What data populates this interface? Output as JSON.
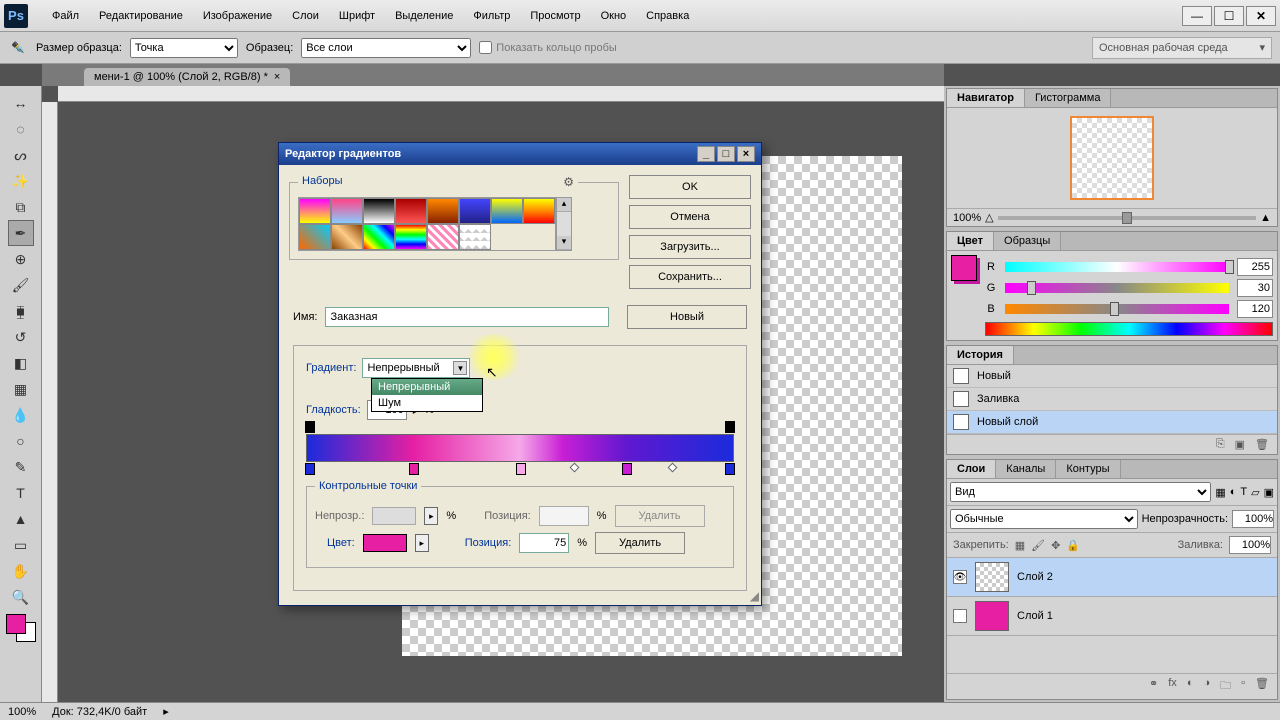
{
  "app": {
    "logo": "Ps"
  },
  "menu": [
    "Файл",
    "Редактирование",
    "Изображение",
    "Слои",
    "Шрифт",
    "Выделение",
    "Фильтр",
    "Просмотр",
    "Окно",
    "Справка"
  ],
  "optbar": {
    "sample_label": "Размер образца:",
    "sample_value": "Точка",
    "src_label": "Образец:",
    "src_value": "Все слои",
    "ring_label": "Показать кольцо пробы",
    "workspace": "Основная рабочая среда"
  },
  "doctab": {
    "title": "мени-1 @ 100% (Слой 2, RGB/8) *"
  },
  "panels": {
    "navigator": {
      "tab1": "Навигатор",
      "tab2": "Гистограмма",
      "zoom": "100%"
    },
    "color": {
      "tab1": "Цвет",
      "tab2": "Образцы",
      "r": "255",
      "g": "30",
      "b": "120"
    },
    "history": {
      "tab": "История",
      "items": [
        "Новый",
        "Заливка",
        "Новый слой"
      ]
    },
    "layers": {
      "tab1": "Слои",
      "tab2": "Каналы",
      "tab3": "Контуры",
      "filter": "Вид",
      "blend": "Обычные",
      "opacity_lbl": "Непрозрачность:",
      "opacity": "100%",
      "lock_lbl": "Закрепить:",
      "fill_lbl": "Заливка:",
      "fill": "100%",
      "items": [
        "Слой 2",
        "Слой 1"
      ]
    }
  },
  "dialog": {
    "title": "Редактор градиентов",
    "presets_lbl": "Наборы",
    "ok": "OK",
    "cancel": "Отмена",
    "load": "Загрузить...",
    "save": "Сохранить...",
    "name_lbl": "Имя:",
    "name_value": "Заказная",
    "new_btn": "Новый",
    "type_lbl": "Градиент:",
    "type_value": "Непрерывный",
    "dd_opt1": "Непрерывный",
    "dd_opt2": "Шум",
    "smooth_lbl": "Гладкость:",
    "smooth_value": "100",
    "cp_lbl": "Контрольные точки",
    "opacity_lbl": "Непрозр.:",
    "pos_lbl": "Позиция:",
    "pos_value": "75",
    "color_lbl": "Цвет:",
    "delete": "Удалить",
    "pct": "%"
  },
  "status": {
    "zoom": "100%",
    "doc": "Док: 732,4K/0 байт"
  }
}
